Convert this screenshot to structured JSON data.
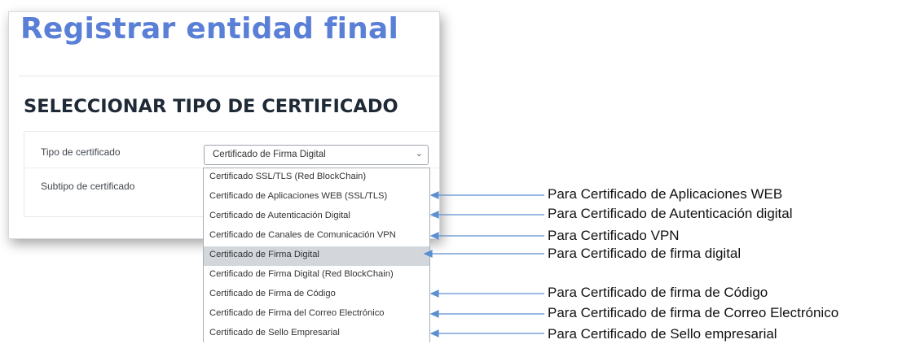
{
  "page": {
    "title": "Registrar entidad final",
    "section_title": "SELECCIONAR TIPO DE CERTIFICADO"
  },
  "form": {
    "tipo_label": "Tipo de certificado",
    "subtipo_label": "Subtipo de certificado",
    "select": {
      "value": "Certificado de Firma Digital",
      "chevron_icon": "chevron-down-icon"
    }
  },
  "dropdown": {
    "selected_index": 4,
    "options": [
      "Certificado SSL/TLS (Red BlockChain)",
      "Certificado de Aplicaciones WEB (SSL/TLS)",
      "Certificado de Autenticación Digital",
      "Certificado de Canales de Comunicación VPN",
      "Certificado de Firma Digital",
      "Certificado de Firma Digital (Red BlockChain)",
      "Certificado de Firma de Código",
      "Certificado de Firma del Correo Electrónico",
      "Certificado de Sello Empresarial"
    ]
  },
  "annotations": [
    "Para Certificado de Aplicaciones WEB",
    "Para Certificado de Autenticación digital",
    "Para Certificado VPN",
    "Para Certificado de firma digital",
    "Para Certificado de firma de Código",
    "Para Certificado de firma de Correo Electrónico",
    "Para Certificado de Sello empresarial"
  ],
  "colors": {
    "title": "#5a7fd6",
    "arrow": "#5b8fd0",
    "selected_option": "#d3d7dc"
  }
}
